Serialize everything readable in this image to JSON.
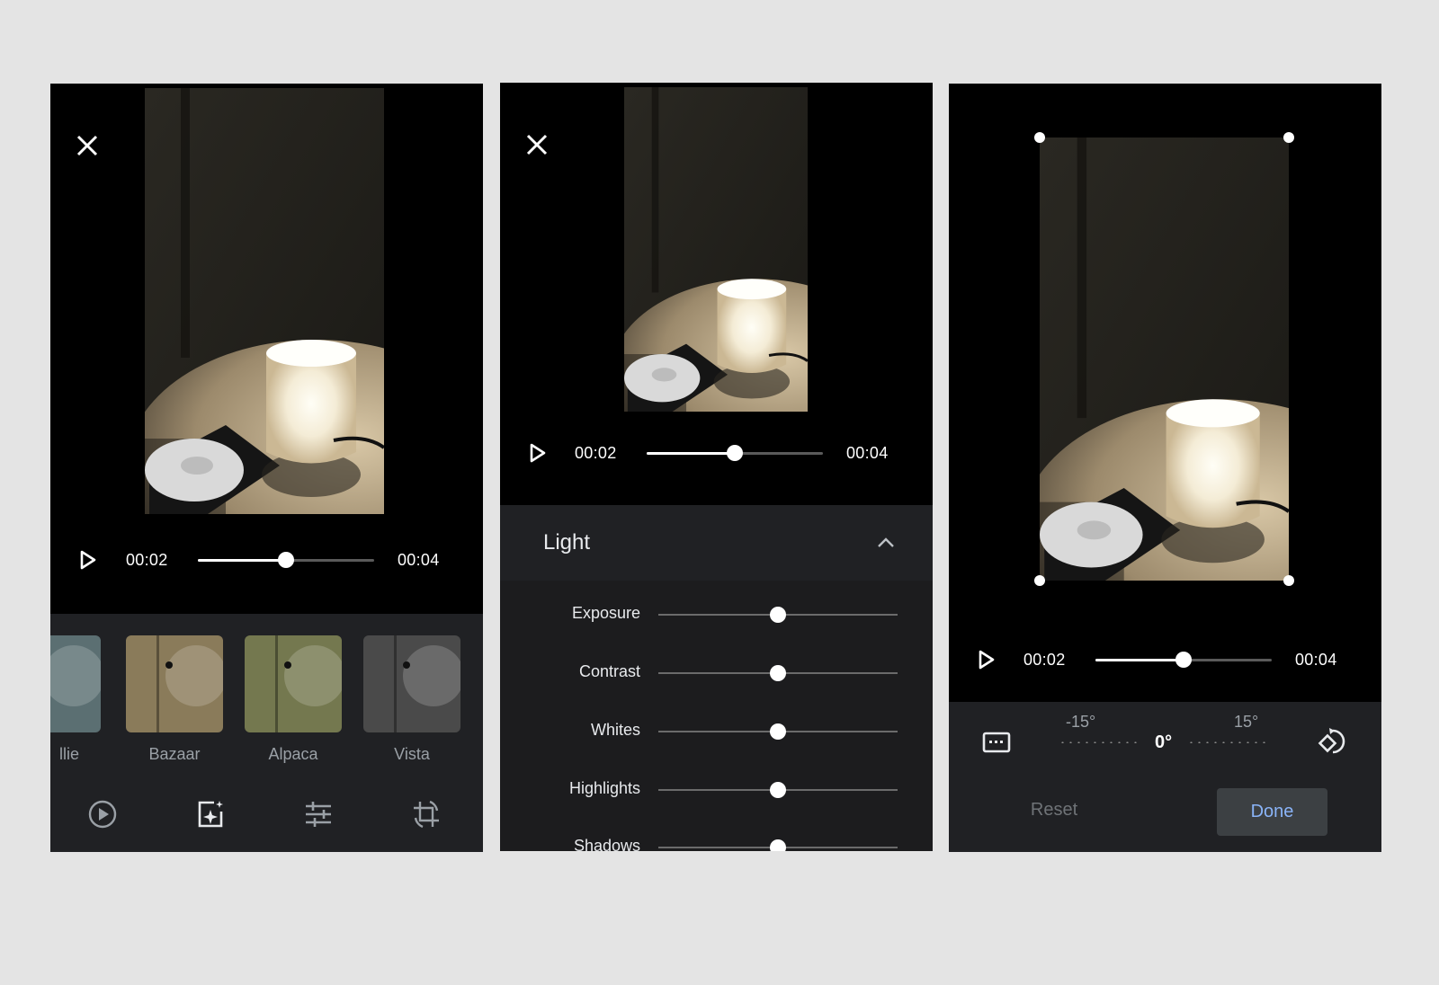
{
  "panels": [
    {
      "name": "filters",
      "current_time": "00:02",
      "duration": "00:04",
      "playback_progress": 0.5,
      "filters": [
        {
          "label": "llie",
          "tint": "#5b6f72"
        },
        {
          "label": "Bazaar",
          "tint": "#8a7b5a"
        },
        {
          "label": "Alpaca",
          "tint": "#74784f"
        },
        {
          "label": "Vista",
          "tint": "#4a4a4a"
        }
      ],
      "toolbar_icons": [
        "video-icon",
        "auto-enhance-icon",
        "adjust-sliders-icon",
        "crop-rotate-icon"
      ]
    },
    {
      "name": "adjust",
      "current_time": "00:02",
      "duration": "00:04",
      "playback_progress": 0.5,
      "section_title": "Light",
      "adjustments": [
        {
          "label": "Exposure",
          "value": 0
        },
        {
          "label": "Contrast",
          "value": 0
        },
        {
          "label": "Whites",
          "value": 0
        },
        {
          "label": "Highlights",
          "value": 0
        },
        {
          "label": "Shadows",
          "value": 0
        }
      ]
    },
    {
      "name": "crop",
      "current_time": "00:02",
      "duration": "00:04",
      "playback_progress": 0.5,
      "rotation_min_label": "-15°",
      "rotation_max_label": "15°",
      "rotation_value_label": "0°",
      "reset_label": "Reset",
      "done_label": "Done"
    }
  ],
  "colors": {
    "background": "#e4e4e4",
    "panel_bg": "#000000",
    "sheet_bg": "#202124",
    "done_text": "#8ab4f8"
  }
}
